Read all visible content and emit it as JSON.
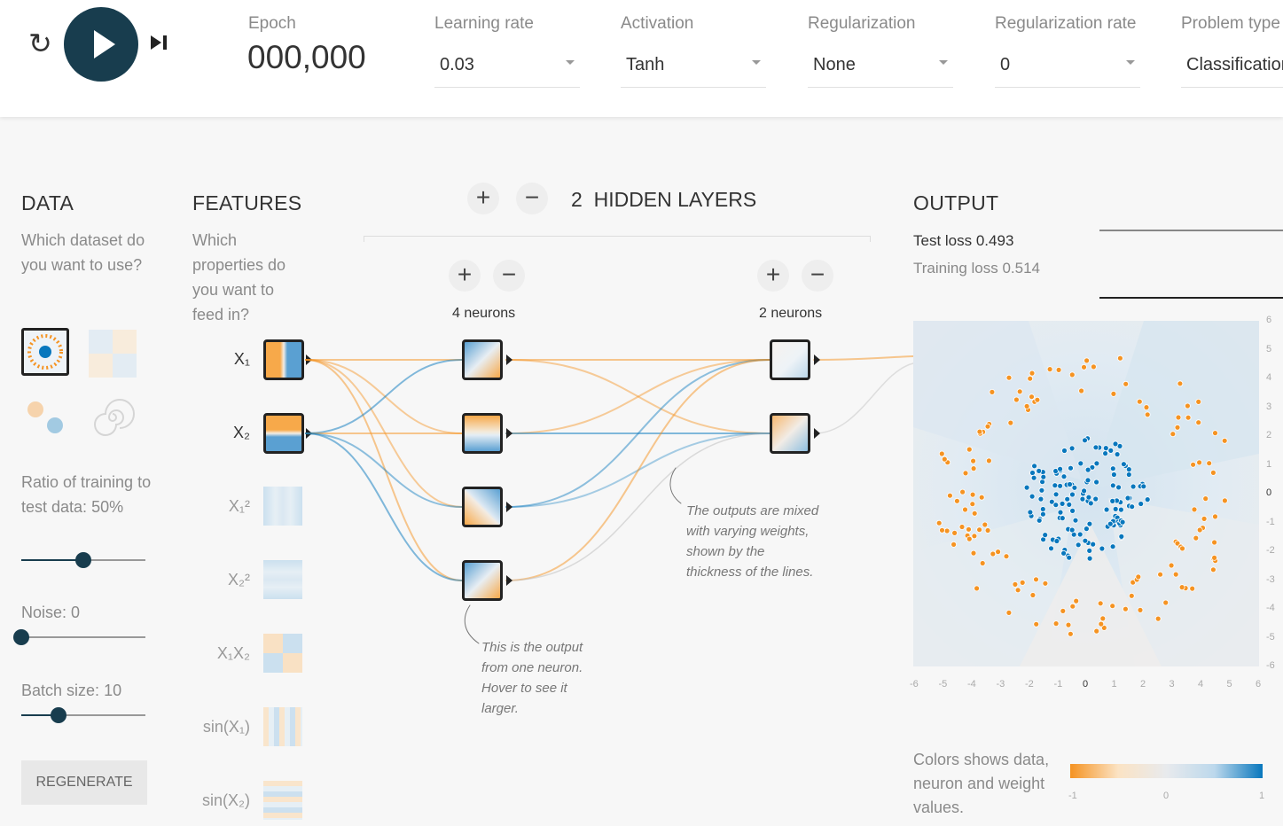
{
  "controls": {
    "epoch": {
      "label": "Epoch",
      "value": "000,000"
    },
    "learning_rate": {
      "label": "Learning rate",
      "value": "0.03"
    },
    "activation": {
      "label": "Activation",
      "value": "Tanh"
    },
    "regularization": {
      "label": "Regularization",
      "value": "None"
    },
    "regularization_rate": {
      "label": "Regularization rate",
      "value": "0"
    },
    "problem_type": {
      "label": "Problem type",
      "value": "Classification"
    }
  },
  "data": {
    "title": "DATA",
    "desc": "Which dataset do you want to use?",
    "ratio_label": "Ratio of training to test data:",
    "ratio_value": "50%",
    "ratio_fraction": 0.5,
    "noise_label": "Noise:",
    "noise_value": "0",
    "noise_fraction": 0,
    "batch_label": "Batch size:",
    "batch_value": "10",
    "batch_fraction": 0.3,
    "regenerate": "REGENERATE"
  },
  "features": {
    "title": "FEATURES",
    "desc": "Which properties do you want to feed in?",
    "items": [
      {
        "label": "X₁",
        "active": true
      },
      {
        "label": "X₂",
        "active": true
      },
      {
        "label": "X₁²",
        "active": false
      },
      {
        "label": "X₂²",
        "active": false
      },
      {
        "label": "X₁X₂",
        "active": false
      },
      {
        "label": "sin(X₁)",
        "active": false
      },
      {
        "label": "sin(X₂)",
        "active": false
      }
    ]
  },
  "hidden": {
    "count": "2",
    "title": "HIDDEN LAYERS",
    "layers": [
      {
        "neurons_label": "4 neurons"
      },
      {
        "neurons_label": "2 neurons"
      }
    ],
    "annotation_neuron": "This is the output from one neuron. Hover to see it larger.",
    "annotation_weights": "The outputs are mixed with varying weights, shown by the thickness of the lines."
  },
  "output": {
    "title": "OUTPUT",
    "test_loss": "Test loss 0.493",
    "training_loss": "Training loss 0.514",
    "x_ticks": [
      "-6",
      "-5",
      "-4",
      "-3",
      "-2",
      "-1",
      "0",
      "1",
      "2",
      "3",
      "4",
      "5",
      "6"
    ],
    "y_ticks": [
      "6",
      "5",
      "4",
      "3",
      "2",
      "1",
      "0",
      "-1",
      "-2",
      "-3",
      "-4",
      "-5",
      "-6"
    ],
    "legend_text": "Colors shows data, neuron and weight values.",
    "legend_ticks": [
      "-1",
      "0",
      "1"
    ]
  },
  "colors": {
    "orange": "#f59322",
    "blue": "#0877bd",
    "dark": "#183d4e"
  }
}
